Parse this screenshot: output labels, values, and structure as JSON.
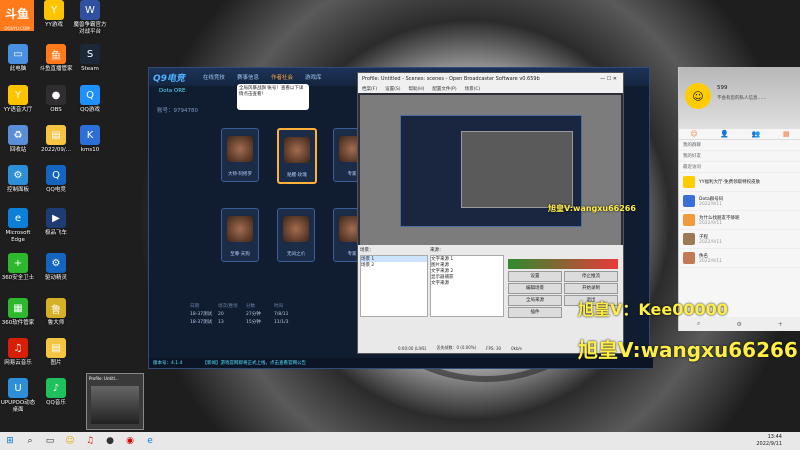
{
  "brand": {
    "logo": "斗鱼",
    "logo_sub": "DOUYU.COM"
  },
  "desktop_icons": [
    {
      "label": "YY游戏",
      "glyph": "Y",
      "bg": "#ffc400"
    },
    {
      "label": "魔兽争霸官方对战平台",
      "glyph": "W",
      "bg": "#3050a0"
    },
    {
      "label": "此电脑",
      "glyph": "▭",
      "bg": "#4a90e2"
    },
    {
      "label": "斗鱼直播管家",
      "glyph": "鱼",
      "bg": "#ff7a1a"
    },
    {
      "label": "Steam",
      "glyph": "S",
      "bg": "#1b2838"
    },
    {
      "label": "YY语音大厅",
      "glyph": "Y",
      "bg": "#ffc400"
    },
    {
      "label": "OBS",
      "glyph": "●",
      "bg": "#302e31"
    },
    {
      "label": "QQ游戏",
      "glyph": "Q",
      "bg": "#1e90ff"
    },
    {
      "label": "回收站",
      "glyph": "♻",
      "bg": "#5a8fd8"
    },
    {
      "label": "2022/09/...",
      "glyph": "▤",
      "bg": "#f5c542"
    },
    {
      "label": "kms10",
      "glyph": "K",
      "bg": "#2d6fd8"
    },
    {
      "label": "控制面板",
      "glyph": "⚙",
      "bg": "#2d8fd8"
    },
    {
      "label": "QQ电竞",
      "glyph": "Q",
      "bg": "#1565c0"
    },
    {
      "label": "Microsoft Edge",
      "glyph": "e",
      "bg": "#0c7fd8"
    },
    {
      "label": "极品飞车",
      "glyph": "▶",
      "bg": "#1f3b73"
    },
    {
      "label": "360安全卫士",
      "glyph": "+",
      "bg": "#2eb82e"
    },
    {
      "label": "驱动精灵",
      "glyph": "⚙",
      "bg": "#1565c0"
    },
    {
      "label": "360软件管家",
      "glyph": "▦",
      "bg": "#2eb82e"
    },
    {
      "label": "鲁大师",
      "glyph": "鲁",
      "bg": "#d6b026"
    },
    {
      "label": "网易云音乐",
      "glyph": "♫",
      "bg": "#d81e06"
    },
    {
      "label": "图片",
      "glyph": "▤",
      "bg": "#f5c542"
    },
    {
      "label": "UPUPOO动态桌面",
      "glyph": "U",
      "bg": "#2d8fd8"
    },
    {
      "label": "QQ音乐",
      "glyph": "♪",
      "bg": "#20c05c"
    }
  ],
  "game": {
    "logo": "Q9电竞",
    "tabs": [
      "在线竞技",
      "赛事信息",
      "作者社会",
      "游戏库"
    ],
    "active_tab": "作者社会",
    "sub_tab": "Dota ORE",
    "account_label": "账号：9794780",
    "cards": [
      "大师·阿修罗",
      "骷髅·玫瑰",
      "专家",
      "专家·天狗"
    ],
    "bottom_cards": [
      "至尊·天狗",
      "无间之爪",
      "专家"
    ],
    "tooltip": "全局风暴战旗 账号！查看以下详情点击查看！",
    "table_header": [
      "日期",
      "场次/胜场",
      "分数",
      "时间"
    ],
    "table_rows": [
      [
        "18-37测试",
        "20",
        "27分钟",
        "7/8/11"
      ],
      [
        "18-37测试",
        "13",
        "15分钟",
        "11/1/3"
      ]
    ],
    "status_bar": "【新闻】游戏官网即将正式上线，点击查看官网公告",
    "version": "版本号：4.1.4"
  },
  "obs": {
    "title": "Profile: Untitled - Scenes: scenes - Open Broadcaster Software v0.659b",
    "menu": [
      "档案(F)",
      "设置(S)",
      "帮助(H)",
      "配置文件(P)",
      "场景(C)"
    ],
    "scenes_label": "场景：",
    "scenes": [
      "场景 1",
      "场景 2"
    ],
    "sources_label": "来源：",
    "sources": [
      "文字来源 1",
      "图片来源",
      "文字来源 2",
      "显示器捕获",
      "文字来源"
    ],
    "buttons": [
      "设置",
      "停止推流",
      "编辑场景",
      "开始录制",
      "全局来源",
      "插件",
      "退出"
    ],
    "status": [
      "0:00:00 (LIVE)",
      "丢失帧数：0 (0.00%)",
      "FPS: 30",
      "0kb/s"
    ]
  },
  "chat": {
    "username": "599",
    "signature": "不会有您的私人信息……",
    "tabs": [
      "☺",
      "👤",
      "👥",
      "▦"
    ],
    "sections": [
      "我的群聊",
      "我的好友",
      "最近访问"
    ],
    "items": [
      {
        "name": "YY福利大厅-免费领取特权皮肤",
        "time": "",
        "color": "#ffcc00"
      },
      {
        "name": "Dota群号码",
        "time": "2022/9/11",
        "color": "#3a6fd8"
      },
      {
        "name": "为什么找朋友不够呢",
        "time": "2022/9/11",
        "color": "#f29a3a"
      },
      {
        "name": "子程",
        "time": "2022/9/11",
        "color": "#9b7a55"
      },
      {
        "name": "佚名",
        "time": "2022/9/11",
        "color": "#c27a55"
      }
    ]
  },
  "watermarks": {
    "line1": "旭皇V：Kee00000",
    "line2": "旭皇V:wangxu66266",
    "small": "旭皇V:wangxu66266"
  },
  "thumbnail": {
    "title": "Profile: Untitl..."
  },
  "taskbar": {
    "time": "13:44",
    "date": "2022/9/11"
  }
}
